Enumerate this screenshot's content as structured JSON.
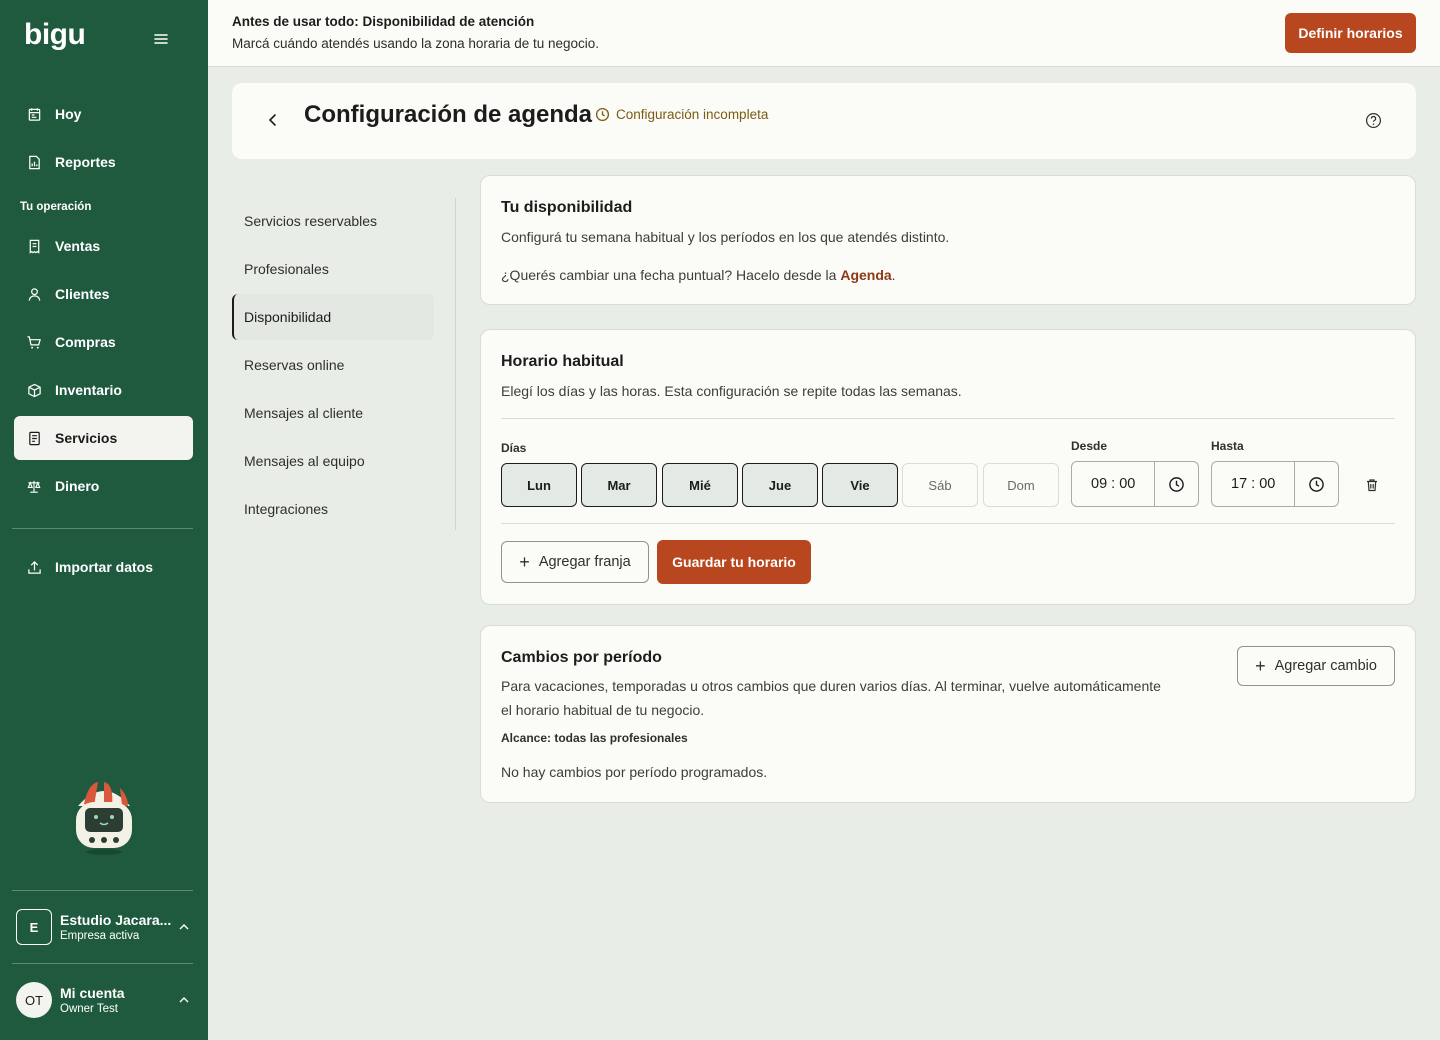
{
  "brand": {
    "logo": "bigu",
    "primary_color": "#1f5a3f",
    "accent_color": "#b8461f"
  },
  "sidebar": {
    "items_top": [
      {
        "label": "Hoy",
        "icon": "calendar-today-icon"
      },
      {
        "label": "Reportes",
        "icon": "report-icon"
      }
    ],
    "section_label": "Tu operación",
    "items_ops": [
      {
        "label": "Ventas",
        "icon": "receipt-icon"
      },
      {
        "label": "Clientes",
        "icon": "user-icon"
      },
      {
        "label": "Compras",
        "icon": "cart-icon"
      },
      {
        "label": "Inventario",
        "icon": "box-icon"
      },
      {
        "label": "Servicios",
        "icon": "services-icon",
        "active": true
      },
      {
        "label": "Dinero",
        "icon": "scale-icon"
      }
    ],
    "import": {
      "label": "Importar datos",
      "icon": "upload-icon"
    },
    "business": {
      "initial": "E",
      "name": "Estudio Jacara...",
      "status": "Empresa activa"
    },
    "account": {
      "initials": "OT",
      "title": "Mi cuenta",
      "name": "Owner Test"
    }
  },
  "banner": {
    "title": "Antes de usar todo: Disponibilidad de atención",
    "subtitle": "Marcá cuándo atendés usando la zona horaria de tu negocio.",
    "button": "Definir horarios"
  },
  "header": {
    "title": "Configuración de agenda",
    "status": "Configuración incompleta"
  },
  "subnav": {
    "items": [
      "Servicios reservables",
      "Profesionales",
      "Disponibilidad",
      "Reservas online",
      "Mensajes al cliente",
      "Mensajes al equipo",
      "Integraciones"
    ],
    "active_index": 2
  },
  "availability": {
    "title": "Tu disponibilidad",
    "description": "Configurá tu semana habitual y los períodos en los que atendés distinto.",
    "note_prefix": "¿Querés cambiar una fecha puntual? Hacelo desde la ",
    "note_link": "Agenda",
    "note_suffix": "."
  },
  "schedule": {
    "title": "Horario habitual",
    "description": "Elegí los días y las horas. Esta configuración se repite todas las semanas.",
    "days_label": "Días",
    "days": [
      {
        "label": "Lun",
        "selected": true
      },
      {
        "label": "Mar",
        "selected": true
      },
      {
        "label": "Mié",
        "selected": true
      },
      {
        "label": "Jue",
        "selected": true
      },
      {
        "label": "Vie",
        "selected": true
      },
      {
        "label": "Sáb",
        "selected": false
      },
      {
        "label": "Dom",
        "selected": false
      }
    ],
    "from_label": "Desde",
    "from_value": "09 : 00",
    "to_label": "Hasta",
    "to_value": "17 : 00",
    "add_slot": "Agregar franja",
    "save": "Guardar tu horario"
  },
  "period_changes": {
    "title": "Cambios por período",
    "description_line1": "Para vacaciones, temporadas u otros cambios que duren varios días. Al terminar, vuelve automáticamente",
    "description_line2": "el horario habitual de tu negocio.",
    "scope": "Alcance: todas las profesionales",
    "empty": "No hay cambios por período programados.",
    "add_button": "Agregar cambio"
  }
}
